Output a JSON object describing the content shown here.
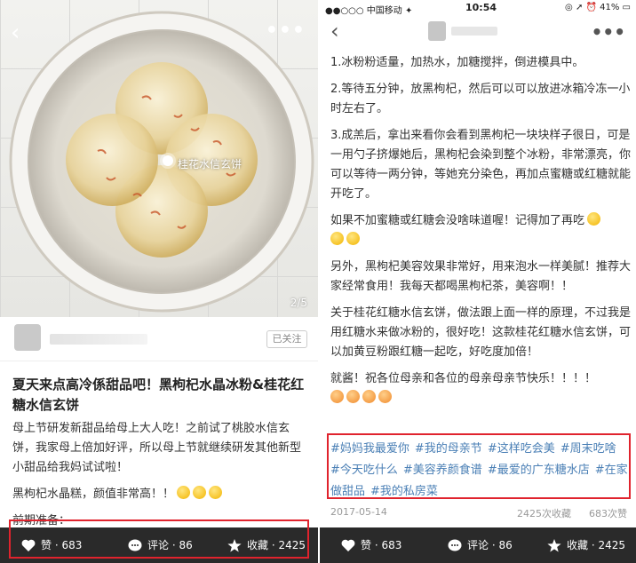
{
  "left": {
    "photo": {
      "tag_label": "桂花水信玄饼",
      "page_indicator": "2/5"
    },
    "author": {
      "follow_label": "已关注"
    },
    "title": "夏天来点高冷係甜品吧！黑枸杞水晶冰粉&桂花红糖水信玄饼",
    "body": [
      "母上节研发新甜品给母上大人吃！之前试了桃胶水信玄饼，我家母上倍加好评，所以母上节就继续研发其他新型小甜品给我妈试试啦！",
      "黑枸杞水晶糕，颜值非常高！！",
      "前期准备："
    ],
    "bottom_bar": {
      "like_label": "赞 · 683",
      "comment_label": "评论 · 86",
      "collect_label": "收藏 · 2425"
    }
  },
  "right": {
    "status": {
      "carrier": "●●○○○ 中国移动  ✦",
      "time": "10:54",
      "battery": "◎ ➚ ⏰ 41% ▭"
    },
    "body": [
      "1.冰粉粉适量，加热水，加糖搅拌，倒进模具中。",
      "2.等待五分钟，放黑枸杞，然后可以可以放进冰箱冷冻一小时左右了。",
      "3.成羔后，拿出来看你会看到黑枸杞一块块样子很日，可是一用勺子挤爆她后，黑枸杞会染到整个冰粉，非常漂亮，你可以等待一两分钟，等她充分染色，再加点蜜糖或红糖就能开吃了。",
      "如果不加蜜糖或红糖会没啥味道喔！记得加了再吃",
      "另外，黑枸杞美容效果非常好，用来泡水一样美腻！推荐大家经常食用！我每天都喝黑枸杞茶，美容啊！！",
      "关于桂花红糖水信玄饼，做法跟上面一样的原理，不过我是用红糖水来做冰粉的，很好吃！这款桂花红糖水信玄饼，可以加黄豆粉跟红糖一起吃，好吃度加倍！",
      "就酱！祝各位母亲和各位的母亲母亲节快乐！！！！"
    ],
    "tags": [
      "#妈妈我最爱你",
      "#我的母亲节",
      "#这样吃会美",
      "#周末吃啥",
      "#今天吃什么",
      "#美容养颜食谱",
      "#最爱的广东糖水店",
      "#在家做甜品",
      "#我的私房菜"
    ],
    "meta": {
      "date": "2017-05-14",
      "favorites": "2425次收藏",
      "views": "683次赞"
    },
    "bottom_bar": {
      "like_label": "赞 · 683",
      "comment_label": "评论 · 86",
      "collect_label": "收藏 · 2425"
    }
  },
  "colors": {
    "highlight": "#e0232d",
    "tag_blue": "#4a7fb5",
    "bar_bg": "#2a2a2a"
  },
  "icons": [
    "back-icon",
    "more-icon",
    "heart-icon",
    "comment-icon",
    "star-icon",
    "emoji-icon"
  ]
}
